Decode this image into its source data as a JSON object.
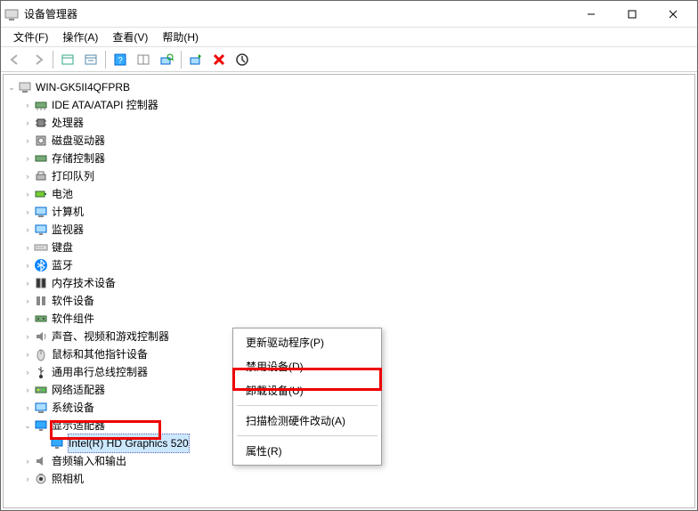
{
  "window": {
    "title": "设备管理器"
  },
  "menubar": [
    "文件(F)",
    "操作(A)",
    "查看(V)",
    "帮助(H)"
  ],
  "root": {
    "label": "WIN-GK5II4QFPRB"
  },
  "categories": [
    {
      "label": "IDE ATA/ATAPI 控制器",
      "icon": "ide"
    },
    {
      "label": "处理器",
      "icon": "cpu"
    },
    {
      "label": "磁盘驱动器",
      "icon": "disk"
    },
    {
      "label": "存储控制器",
      "icon": "storage"
    },
    {
      "label": "打印队列",
      "icon": "printer"
    },
    {
      "label": "电池",
      "icon": "battery"
    },
    {
      "label": "计算机",
      "icon": "computer"
    },
    {
      "label": "监视器",
      "icon": "monitor"
    },
    {
      "label": "键盘",
      "icon": "keyboard"
    },
    {
      "label": "蓝牙",
      "icon": "bluetooth"
    },
    {
      "label": "内存技术设备",
      "icon": "memory"
    },
    {
      "label": "软件设备",
      "icon": "software"
    },
    {
      "label": "软件组件",
      "icon": "component"
    },
    {
      "label": "声音、视频和游戏控制器",
      "icon": "sound"
    },
    {
      "label": "鼠标和其他指针设备",
      "icon": "mouse"
    },
    {
      "label": "通用串行总线控制器",
      "icon": "usb"
    },
    {
      "label": "网络适配器",
      "icon": "network"
    },
    {
      "label": "系统设备",
      "icon": "system"
    },
    {
      "label": "显示适配器",
      "icon": "display",
      "expanded": true,
      "children": [
        {
          "label": "Intel(R) HD Graphics 520",
          "icon": "display",
          "selected": true
        }
      ]
    },
    {
      "label": "音频输入和输出",
      "icon": "audio"
    },
    {
      "label": "照相机",
      "icon": "camera"
    }
  ],
  "context_menu": [
    {
      "label": "更新驱动程序(P)"
    },
    {
      "label": "禁用设备(D)"
    },
    {
      "label": "卸载设备(U)"
    },
    {
      "sep": true
    },
    {
      "label": "扫描检测硬件改动(A)"
    },
    {
      "sep": true
    },
    {
      "label": "属性(R)"
    }
  ]
}
